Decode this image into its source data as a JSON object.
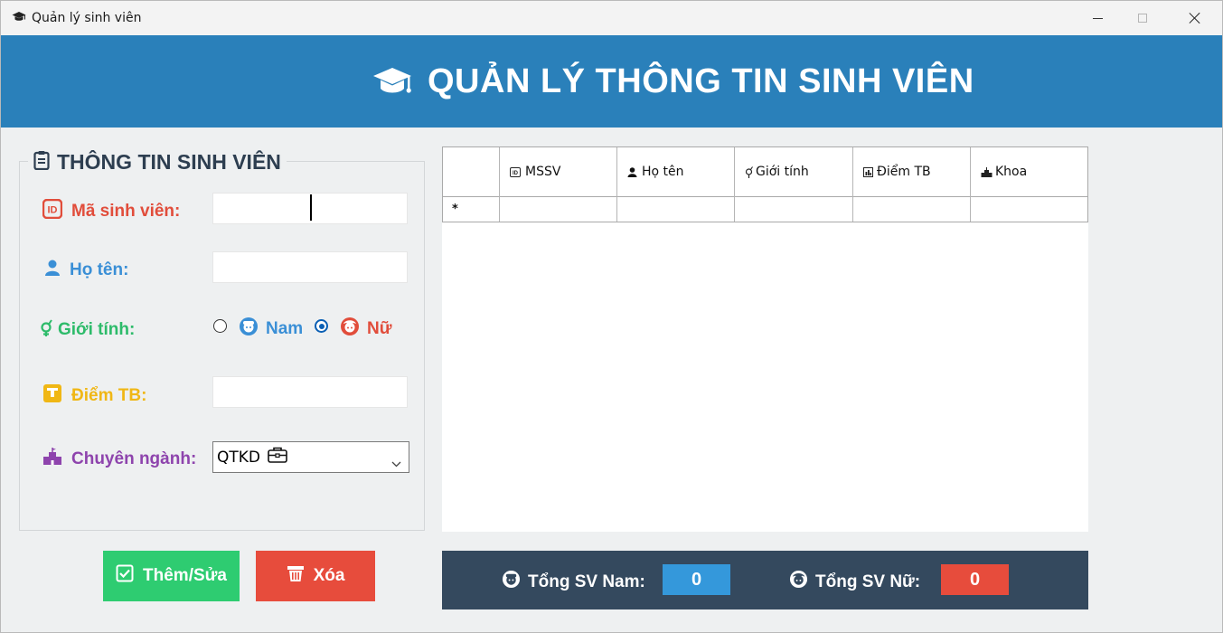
{
  "window": {
    "title": "Quản lý sinh viên",
    "app_icon": "graduation-cap-icon"
  },
  "banner": {
    "title": "QUẢN LÝ THÔNG TIN SINH VIÊN",
    "background": "#2a80ba"
  },
  "form": {
    "group_title": "THÔNG TIN SINH VIÊN",
    "student_id_label": "Mã sinh viên:",
    "student_id_value": "",
    "name_label": "Họ tên:",
    "name_value": "",
    "gender_label": "Giới tính:",
    "gender_options": [
      {
        "label": "Nam",
        "checked": false
      },
      {
        "label": "Nữ",
        "checked": true
      }
    ],
    "gpa_label": "Điểm TB:",
    "gpa_value": "",
    "major_label": "Chuyên ngành:",
    "major_value": "QTKD"
  },
  "buttons": {
    "save_label": "Thêm/Sửa",
    "delete_label": "Xóa"
  },
  "table": {
    "columns": [
      "MSSV",
      "Họ tên",
      "Giới tính",
      "Điểm TB",
      "Khoa"
    ],
    "new_row_marker": "*",
    "rows": []
  },
  "stats": {
    "male_label": "Tổng SV Nam:",
    "male_count": "0",
    "female_label": "Tổng SV Nữ:",
    "female_count": "0"
  },
  "colors": {
    "accent_blue": "#2a80ba",
    "save_green": "#2ecc71",
    "delete_red": "#e74c3c",
    "stats_bg": "#34495e"
  }
}
